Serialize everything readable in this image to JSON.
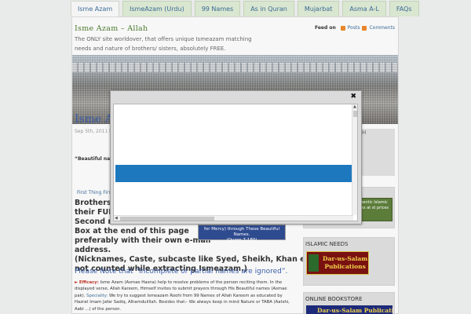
{
  "nav": {
    "tabs": [
      {
        "label": "Isme Azam",
        "active": true
      },
      {
        "label": "IsmeAzam (Urdu)",
        "active": false
      },
      {
        "label": "99 Names",
        "active": false
      },
      {
        "label": "As in Quran",
        "active": false
      },
      {
        "label": "Mujarbat",
        "active": false
      },
      {
        "label": "Asma A-L",
        "active": false
      },
      {
        "label": "FAQs",
        "active": false
      }
    ]
  },
  "header": {
    "site_title": "Isme Azam – Allah",
    "description": "The ONLY site worldover, that offers unique Ismeazam matching needs and nature of brothers/ sisters, absolutely FREE.",
    "feed_label": "Feed on",
    "feed_posts": "Posts",
    "feed_comments": "Comments"
  },
  "post": {
    "title_fragment": "Isme Az",
    "date_fragment": "Sep 5th, 2011 b",
    "beautiful_names": "“Beautiful nam",
    "first_thing": "First Thing First",
    "lines": [
      "Brothers/",
      "their FULL",
      "Second na",
      "Box at the end of this page",
      "preferably with their own e-mail",
      "address.",
      "(Nicknames, Caste, subcaste  like Syed, Sheikh, Khan etc are",
      "not counted while extracting Ismeazam.)"
    ],
    "note": "Please Note that “Incomplete or partial names are ignored”.",
    "quran_box": [
      "for Mercy) through  These Beautiful Names.",
      "(Quran 7-180)"
    ],
    "efficacy_label": "► Efficacy:",
    "efficacy_text": " Isme Azam (Asmae Hasna) help  to resolve problems of the person  reciting them. In the displayed verse, Allah Kareem, Himself invites to submit prayers through His Beautiful names (Asmae pak). ",
    "speciality_label": "Speciality:",
    "speciality_text": " We try to suggest Ismeazam Roohi from  99 Names of Allah Kareem as educated by Hazrat Imam Jafar Sadiq, Alhamdulillah. Besides that:- We always keep in mind Nature or TABA (Aatshi, Aabi ...) of the person."
  },
  "sidebar": {
    "dim_fragment": "H",
    "ad1_text": "uthentic Islamic ooks at st prices",
    "islamic_needs": "ISLAMIC NEEDS",
    "darussalam_line1": "Dar-us-Salam",
    "darussalam_line2": "Publications",
    "online_bookstore": "ONLINE BOOKSTORE",
    "darussalam_banner": "Dar-us-Salam Publications"
  },
  "popup": {
    "close_glyph": "✖",
    "bar_color": "#1d78be"
  },
  "colors": {
    "link": "#3a6a97",
    "title_green": "#4c7a2e",
    "post_blue": "#3a5ea8",
    "efficacy_red": "#c0392b"
  }
}
